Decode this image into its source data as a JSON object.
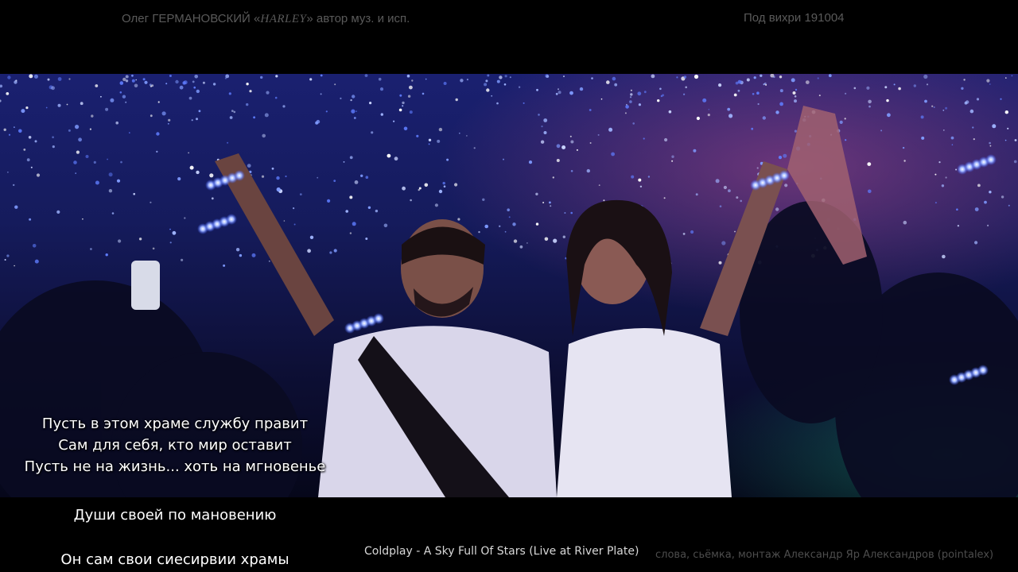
{
  "header": {
    "author_prefix": "Олег ГЕРМАНОВСКИЙ «",
    "author_brand": "HARLEY",
    "author_suffix": "» автор муз. и исп.",
    "piece_title": "Под вихри 191004"
  },
  "photo": {
    "description_icon": "concert-crowd-photo",
    "accent_colors": [
      "#1a1f6b",
      "#3b5bff",
      "#9fb4ff",
      "#c04aa0"
    ]
  },
  "lyrics": {
    "overlay_lines": [
      "Пусть в этом храме службу правит",
      "Сам для себя, кто мир оставит",
      "Пусть не на жизнь... хоть на мгновенье"
    ],
    "line_4": "Души своей по мановению",
    "line_5": "Он сам свои сиесирвии храмы"
  },
  "captions": {
    "song": "Coldplay - A Sky Full Of Stars (Live at River Plate)",
    "credits": "слова, сьёмка, монтаж  Александр Яр Александров  (pointalex)"
  }
}
